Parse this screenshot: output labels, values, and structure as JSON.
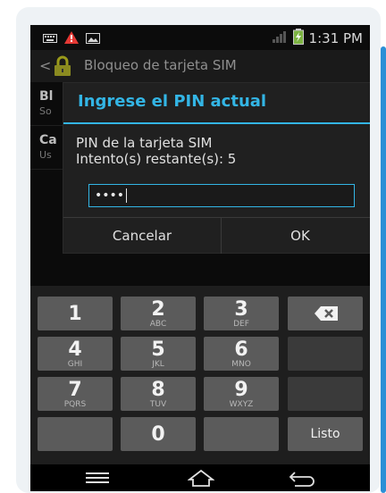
{
  "status_bar": {
    "time": "1:31 PM",
    "icons": [
      "keyboard-icon",
      "warning-icon",
      "image-icon",
      "signal-icon",
      "battery-icon"
    ]
  },
  "action_bar": {
    "title": "Bloqueo de tarjeta SIM",
    "icons": [
      "back-chevron-icon",
      "lock-icon"
    ]
  },
  "background_list": {
    "items": [
      {
        "title": "Bl",
        "subtitle": "So"
      },
      {
        "title": "Ca",
        "subtitle": "Us"
      }
    ]
  },
  "dialog": {
    "title": "Ingrese el PIN actual",
    "message_line1": "PIN de la tarjeta SIM",
    "message_line2": "Intento(s) restante(s): 5",
    "pin_value": "••••",
    "cancel_label": "Cancelar",
    "ok_label": "OK"
  },
  "keypad": {
    "keys": [
      {
        "digit": "1",
        "letters": ""
      },
      {
        "digit": "2",
        "letters": "ABC"
      },
      {
        "digit": "3",
        "letters": "DEF"
      },
      {
        "digit": "4",
        "letters": "GHI"
      },
      {
        "digit": "5",
        "letters": "JKL"
      },
      {
        "digit": "6",
        "letters": "MNO"
      },
      {
        "digit": "7",
        "letters": "PQRS"
      },
      {
        "digit": "8",
        "letters": "TUV"
      },
      {
        "digit": "9",
        "letters": "WXYZ"
      },
      {
        "digit": "0",
        "letters": ""
      }
    ],
    "done_label": "Listo",
    "icons": [
      "backspace-icon"
    ]
  },
  "nav_bar": {
    "icons": [
      "menu-icon",
      "home-icon",
      "back-icon"
    ]
  },
  "colors": {
    "accent": "#33b5e5",
    "frame_accent": "#2b8fd6",
    "key_face": "#5b5b5b",
    "key_dark": "#3a3a3a"
  }
}
